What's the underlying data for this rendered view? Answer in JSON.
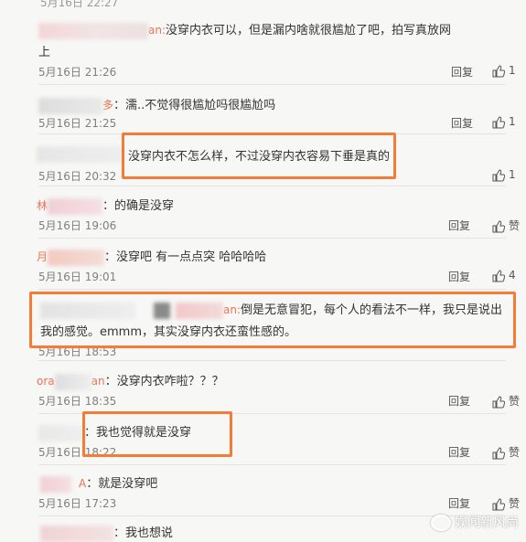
{
  "top_fragment": "5月16日 22:27",
  "reply_label": "回复",
  "like_label": "赞",
  "comments": [
    {
      "nick_fragment": "an:",
      "text_line1": "没穿内衣可以，但是漏内啥就很尴尬了吧，拍写真放网",
      "text_line2": "上",
      "time": "5月16日 21:26",
      "like": "1"
    },
    {
      "nick_fragment": "多",
      "text": "：濡..不觉得很尴尬吗很尴尬吗",
      "time": "5月16日 21:25",
      "like": "1"
    },
    {
      "text": "没穿内衣不怎么样，不过没穿内衣容易下垂是真的",
      "time": "5月16日 20:32",
      "like": "1"
    },
    {
      "nick_fragment": "林",
      "text": "：的确是没穿",
      "time": "5月16日 19:06",
      "like": "赞"
    },
    {
      "nick_fragment": "月",
      "text": "：没穿吧 有一点点突 哈哈哈哈",
      "time": "5月16日 19:01",
      "like": "4"
    },
    {
      "nick_fragment": "an:",
      "text_line1": "倒是无意冒犯，每个人的看法不一样，我只是说出",
      "text_line2": "我的感觉。emmm，其实没穿内衣还蛮性感的。",
      "time": "5月16日 18:53"
    },
    {
      "nick_fragment": "ora",
      "nick_fragment2": "an",
      "text": "：没穿内衣咋啦？？？",
      "time": "5月16日 18:35",
      "like": "赞"
    },
    {
      "text": "：我也觉得就是没穿",
      "time": "5月16日 18:22",
      "like": "赞"
    },
    {
      "nick_fragment": "A",
      "text": "：就是没穿吧",
      "time": "5月16日 17:23",
      "like": "赞"
    },
    {
      "text": "：我也想说"
    }
  ],
  "watermark": "娱闻新风尚",
  "colors": {
    "highlight": "#f57c36",
    "nick": "#eb7350",
    "background": "#f7f7f6"
  }
}
